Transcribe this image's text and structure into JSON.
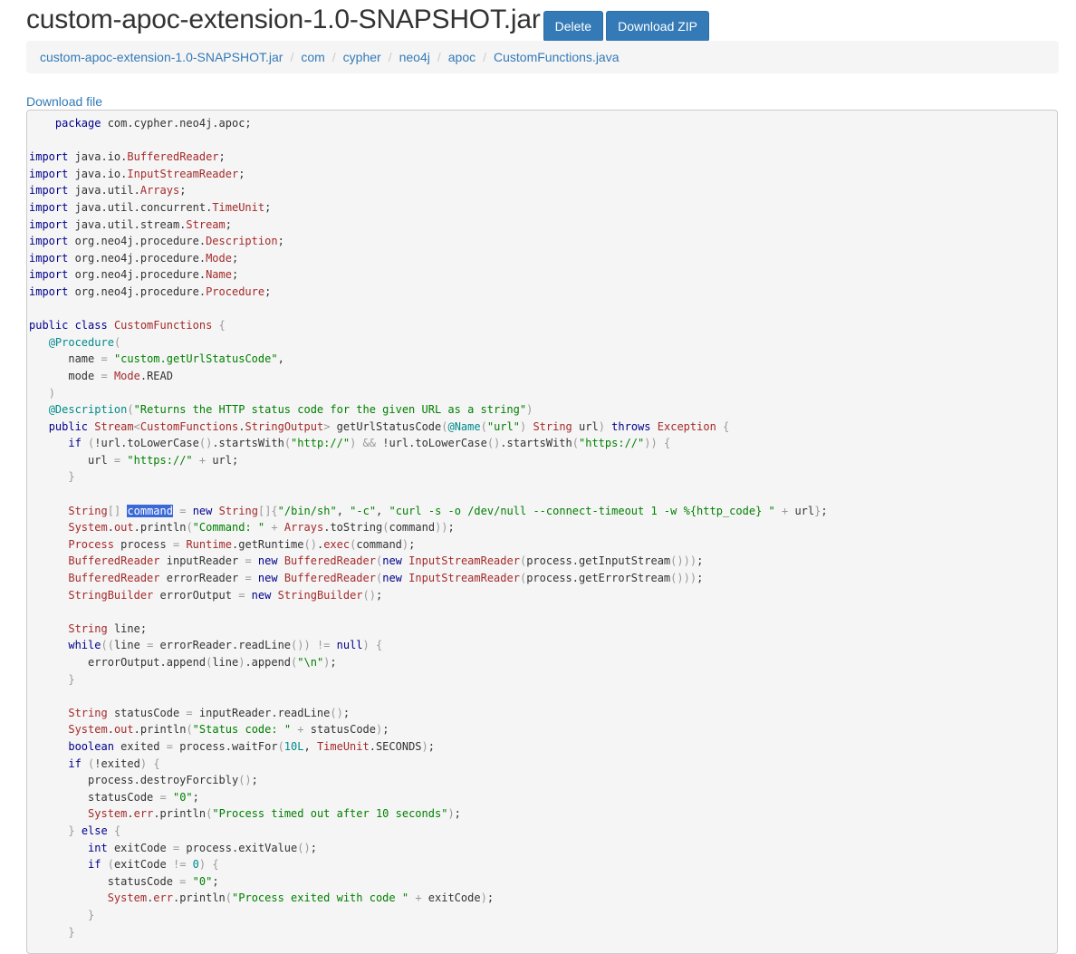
{
  "header": {
    "title": "custom-apoc-extension-1.0-SNAPSHOT.jar",
    "delete_label": "Delete",
    "download_zip_label": "Download ZIP"
  },
  "breadcrumb": [
    "custom-apoc-extension-1.0-SNAPSHOT.jar",
    "com",
    "cypher",
    "neo4j",
    "apoc",
    "CustomFunctions.java"
  ],
  "breadcrumb_separator": "/",
  "download_file_label": "Download file",
  "selected_text": "command",
  "code": [
    [
      [
        "t",
        "    "
      ],
      [
        "k",
        "package"
      ],
      [
        "t",
        " com.cypher.neo4j.apoc;"
      ]
    ],
    [],
    [
      [
        "k",
        "import"
      ],
      [
        "t",
        " java.io."
      ],
      [
        "y",
        "BufferedReader"
      ],
      [
        "t",
        ";"
      ]
    ],
    [
      [
        "k",
        "import"
      ],
      [
        "t",
        " java.io."
      ],
      [
        "y",
        "InputStreamReader"
      ],
      [
        "t",
        ";"
      ]
    ],
    [
      [
        "k",
        "import"
      ],
      [
        "t",
        " java.util."
      ],
      [
        "y",
        "Arrays"
      ],
      [
        "t",
        ";"
      ]
    ],
    [
      [
        "k",
        "import"
      ],
      [
        "t",
        " java.util.concurrent."
      ],
      [
        "y",
        "TimeUnit"
      ],
      [
        "t",
        ";"
      ]
    ],
    [
      [
        "k",
        "import"
      ],
      [
        "t",
        " java.util.stream."
      ],
      [
        "y",
        "Stream"
      ],
      [
        "t",
        ";"
      ]
    ],
    [
      [
        "k",
        "import"
      ],
      [
        "t",
        " org.neo4j.procedure."
      ],
      [
        "y",
        "Description"
      ],
      [
        "t",
        ";"
      ]
    ],
    [
      [
        "k",
        "import"
      ],
      [
        "t",
        " org.neo4j.procedure."
      ],
      [
        "y",
        "Mode"
      ],
      [
        "t",
        ";"
      ]
    ],
    [
      [
        "k",
        "import"
      ],
      [
        "t",
        " org.neo4j.procedure."
      ],
      [
        "y",
        "Name"
      ],
      [
        "t",
        ";"
      ]
    ],
    [
      [
        "k",
        "import"
      ],
      [
        "t",
        " org.neo4j.procedure."
      ],
      [
        "y",
        "Procedure"
      ],
      [
        "t",
        ";"
      ]
    ],
    [],
    [
      [
        "k",
        "public class"
      ],
      [
        "t",
        " "
      ],
      [
        "y",
        "CustomFunctions"
      ],
      [
        "t",
        " "
      ],
      [
        "p",
        "{"
      ]
    ],
    [
      [
        "t",
        "   "
      ],
      [
        "a",
        "@Procedure"
      ],
      [
        "p",
        "("
      ]
    ],
    [
      [
        "t",
        "      name "
      ],
      [
        "p",
        "="
      ],
      [
        "t",
        " "
      ],
      [
        "s",
        "\"custom.getUrlStatusCode\""
      ],
      [
        "t",
        ","
      ]
    ],
    [
      [
        "t",
        "      mode "
      ],
      [
        "p",
        "="
      ],
      [
        "t",
        " "
      ],
      [
        "y",
        "Mode"
      ],
      [
        "t",
        ".READ"
      ]
    ],
    [
      [
        "t",
        "   "
      ],
      [
        "p",
        ")"
      ]
    ],
    [
      [
        "t",
        "   "
      ],
      [
        "a",
        "@Description"
      ],
      [
        "p",
        "("
      ],
      [
        "s",
        "\"Returns the HTTP status code for the given URL as a string\""
      ],
      [
        "p",
        ")"
      ]
    ],
    [
      [
        "t",
        "   "
      ],
      [
        "k",
        "public"
      ],
      [
        "t",
        " "
      ],
      [
        "y",
        "Stream"
      ],
      [
        "p",
        "<"
      ],
      [
        "y",
        "CustomFunctions"
      ],
      [
        "t",
        "."
      ],
      [
        "y",
        "StringOutput"
      ],
      [
        "p",
        ">"
      ],
      [
        "t",
        " getUrlStatusCode"
      ],
      [
        "p",
        "("
      ],
      [
        "a",
        "@Name"
      ],
      [
        "p",
        "("
      ],
      [
        "s",
        "\"url\""
      ],
      [
        "p",
        ")"
      ],
      [
        "t",
        " "
      ],
      [
        "y",
        "String"
      ],
      [
        "t",
        " url"
      ],
      [
        "p",
        ")"
      ],
      [
        "t",
        " "
      ],
      [
        "k",
        "throws"
      ],
      [
        "t",
        " "
      ],
      [
        "y",
        "Exception"
      ],
      [
        "t",
        " "
      ],
      [
        "p",
        "{"
      ]
    ],
    [
      [
        "t",
        "      "
      ],
      [
        "k",
        "if"
      ],
      [
        "t",
        " "
      ],
      [
        "p",
        "("
      ],
      [
        "t",
        "!url.toLowerCase"
      ],
      [
        "p",
        "()"
      ],
      [
        "t",
        ".startsWith"
      ],
      [
        "p",
        "("
      ],
      [
        "s",
        "\"http://\""
      ],
      [
        "p",
        ")"
      ],
      [
        "t",
        " "
      ],
      [
        "p",
        "&&"
      ],
      [
        "t",
        " !url.toLowerCase"
      ],
      [
        "p",
        "()"
      ],
      [
        "t",
        ".startsWith"
      ],
      [
        "p",
        "("
      ],
      [
        "s",
        "\"https://\""
      ],
      [
        "p",
        "))"
      ],
      [
        "t",
        " "
      ],
      [
        "p",
        "{"
      ]
    ],
    [
      [
        "t",
        "         url "
      ],
      [
        "p",
        "="
      ],
      [
        "t",
        " "
      ],
      [
        "s",
        "\"https://\""
      ],
      [
        "t",
        " "
      ],
      [
        "p",
        "+"
      ],
      [
        "t",
        " url;"
      ]
    ],
    [
      [
        "t",
        "      "
      ],
      [
        "p",
        "}"
      ]
    ],
    [],
    [
      [
        "t",
        "      "
      ],
      [
        "y",
        "String"
      ],
      [
        "p",
        "[]"
      ],
      [
        "t",
        " "
      ],
      [
        "h",
        "command"
      ],
      [
        "t",
        " "
      ],
      [
        "p",
        "="
      ],
      [
        "t",
        " "
      ],
      [
        "k",
        "new"
      ],
      [
        "t",
        " "
      ],
      [
        "y",
        "String"
      ],
      [
        "p",
        "[]{"
      ],
      [
        "s",
        "\"/bin/sh\""
      ],
      [
        "t",
        ", "
      ],
      [
        "s",
        "\"-c\""
      ],
      [
        "t",
        ", "
      ],
      [
        "s",
        "\"curl -s -o /dev/null --connect-timeout 1 -w %{http_code} \""
      ],
      [
        "t",
        " "
      ],
      [
        "p",
        "+"
      ],
      [
        "t",
        " url"
      ],
      [
        "p",
        "}"
      ],
      [
        "t",
        ";"
      ]
    ],
    [
      [
        "t",
        "      "
      ],
      [
        "y",
        "System"
      ],
      [
        "t",
        "."
      ],
      [
        "y",
        "out"
      ],
      [
        "t",
        ".println"
      ],
      [
        "p",
        "("
      ],
      [
        "s",
        "\"Command: \""
      ],
      [
        "t",
        " "
      ],
      [
        "p",
        "+"
      ],
      [
        "t",
        " "
      ],
      [
        "y",
        "Arrays"
      ],
      [
        "t",
        ".toString"
      ],
      [
        "p",
        "("
      ],
      [
        "t",
        "command"
      ],
      [
        "p",
        "))"
      ],
      [
        "t",
        ";"
      ]
    ],
    [
      [
        "t",
        "      "
      ],
      [
        "y",
        "Process"
      ],
      [
        "t",
        " process "
      ],
      [
        "p",
        "="
      ],
      [
        "t",
        " "
      ],
      [
        "y",
        "Runtime"
      ],
      [
        "t",
        ".getRuntime"
      ],
      [
        "p",
        "()"
      ],
      [
        "t",
        "."
      ],
      [
        "y",
        "exec"
      ],
      [
        "p",
        "("
      ],
      [
        "t",
        "command"
      ],
      [
        "p",
        ")"
      ],
      [
        "t",
        ";"
      ]
    ],
    [
      [
        "t",
        "      "
      ],
      [
        "y",
        "BufferedReader"
      ],
      [
        "t",
        " inputReader "
      ],
      [
        "p",
        "="
      ],
      [
        "t",
        " "
      ],
      [
        "k",
        "new"
      ],
      [
        "t",
        " "
      ],
      [
        "y",
        "BufferedReader"
      ],
      [
        "p",
        "("
      ],
      [
        "k",
        "new"
      ],
      [
        "t",
        " "
      ],
      [
        "y",
        "InputStreamReader"
      ],
      [
        "p",
        "("
      ],
      [
        "t",
        "process.getInputStream"
      ],
      [
        "p",
        "()))"
      ],
      [
        "t",
        ";"
      ]
    ],
    [
      [
        "t",
        "      "
      ],
      [
        "y",
        "BufferedReader"
      ],
      [
        "t",
        " errorReader "
      ],
      [
        "p",
        "="
      ],
      [
        "t",
        " "
      ],
      [
        "k",
        "new"
      ],
      [
        "t",
        " "
      ],
      [
        "y",
        "BufferedReader"
      ],
      [
        "p",
        "("
      ],
      [
        "k",
        "new"
      ],
      [
        "t",
        " "
      ],
      [
        "y",
        "InputStreamReader"
      ],
      [
        "p",
        "("
      ],
      [
        "t",
        "process.getErrorStream"
      ],
      [
        "p",
        "()))"
      ],
      [
        "t",
        ";"
      ]
    ],
    [
      [
        "t",
        "      "
      ],
      [
        "y",
        "StringBuilder"
      ],
      [
        "t",
        " errorOutput "
      ],
      [
        "p",
        "="
      ],
      [
        "t",
        " "
      ],
      [
        "k",
        "new"
      ],
      [
        "t",
        " "
      ],
      [
        "y",
        "StringBuilder"
      ],
      [
        "p",
        "()"
      ],
      [
        "t",
        ";"
      ]
    ],
    [],
    [
      [
        "t",
        "      "
      ],
      [
        "y",
        "String"
      ],
      [
        "t",
        " line;"
      ]
    ],
    [
      [
        "t",
        "      "
      ],
      [
        "k",
        "while"
      ],
      [
        "p",
        "(("
      ],
      [
        "t",
        "line "
      ],
      [
        "p",
        "="
      ],
      [
        "t",
        " errorReader.readLine"
      ],
      [
        "p",
        "())"
      ],
      [
        "t",
        " "
      ],
      [
        "p",
        "!="
      ],
      [
        "t",
        " "
      ],
      [
        "k",
        "null"
      ],
      [
        "p",
        ")"
      ],
      [
        "t",
        " "
      ],
      [
        "p",
        "{"
      ]
    ],
    [
      [
        "t",
        "         errorOutput.append"
      ],
      [
        "p",
        "("
      ],
      [
        "t",
        "line"
      ],
      [
        "p",
        ")"
      ],
      [
        "t",
        ".append"
      ],
      [
        "p",
        "("
      ],
      [
        "s",
        "\"\\n\""
      ],
      [
        "p",
        ")"
      ],
      [
        "t",
        ";"
      ]
    ],
    [
      [
        "t",
        "      "
      ],
      [
        "p",
        "}"
      ]
    ],
    [],
    [
      [
        "t",
        "      "
      ],
      [
        "y",
        "String"
      ],
      [
        "t",
        " statusCode "
      ],
      [
        "p",
        "="
      ],
      [
        "t",
        " inputReader.readLine"
      ],
      [
        "p",
        "()"
      ],
      [
        "t",
        ";"
      ]
    ],
    [
      [
        "t",
        "      "
      ],
      [
        "y",
        "System"
      ],
      [
        "t",
        "."
      ],
      [
        "y",
        "out"
      ],
      [
        "t",
        ".println"
      ],
      [
        "p",
        "("
      ],
      [
        "s",
        "\"Status code: \""
      ],
      [
        "t",
        " "
      ],
      [
        "p",
        "+"
      ],
      [
        "t",
        " statusCode"
      ],
      [
        "p",
        ")"
      ],
      [
        "t",
        ";"
      ]
    ],
    [
      [
        "t",
        "      "
      ],
      [
        "k",
        "boolean"
      ],
      [
        "t",
        " exited "
      ],
      [
        "p",
        "="
      ],
      [
        "t",
        " process.waitFor"
      ],
      [
        "p",
        "("
      ],
      [
        "a",
        "10L"
      ],
      [
        "t",
        ", "
      ],
      [
        "y",
        "TimeUnit"
      ],
      [
        "t",
        ".SECONDS"
      ],
      [
        "p",
        ")"
      ],
      [
        "t",
        ";"
      ]
    ],
    [
      [
        "t",
        "      "
      ],
      [
        "k",
        "if"
      ],
      [
        "t",
        " "
      ],
      [
        "p",
        "("
      ],
      [
        "t",
        "!exited"
      ],
      [
        "p",
        ")"
      ],
      [
        "t",
        " "
      ],
      [
        "p",
        "{"
      ]
    ],
    [
      [
        "t",
        "         process.destroyForcibly"
      ],
      [
        "p",
        "()"
      ],
      [
        "t",
        ";"
      ]
    ],
    [
      [
        "t",
        "         statusCode "
      ],
      [
        "p",
        "="
      ],
      [
        "t",
        " "
      ],
      [
        "s",
        "\"0\""
      ],
      [
        "t",
        ";"
      ]
    ],
    [
      [
        "t",
        "         "
      ],
      [
        "y",
        "System"
      ],
      [
        "t",
        "."
      ],
      [
        "y",
        "err"
      ],
      [
        "t",
        ".println"
      ],
      [
        "p",
        "("
      ],
      [
        "s",
        "\"Process timed out after 10 seconds\""
      ],
      [
        "p",
        ")"
      ],
      [
        "t",
        ";"
      ]
    ],
    [
      [
        "t",
        "      "
      ],
      [
        "p",
        "}"
      ],
      [
        "t",
        " "
      ],
      [
        "k",
        "else"
      ],
      [
        "t",
        " "
      ],
      [
        "p",
        "{"
      ]
    ],
    [
      [
        "t",
        "         "
      ],
      [
        "k",
        "int"
      ],
      [
        "t",
        " exitCode "
      ],
      [
        "p",
        "="
      ],
      [
        "t",
        " process.exitValue"
      ],
      [
        "p",
        "()"
      ],
      [
        "t",
        ";"
      ]
    ],
    [
      [
        "t",
        "         "
      ],
      [
        "k",
        "if"
      ],
      [
        "t",
        " "
      ],
      [
        "p",
        "("
      ],
      [
        "t",
        "exitCode "
      ],
      [
        "p",
        "!="
      ],
      [
        "t",
        " "
      ],
      [
        "a",
        "0"
      ],
      [
        "p",
        ")"
      ],
      [
        "t",
        " "
      ],
      [
        "p",
        "{"
      ]
    ],
    [
      [
        "t",
        "            statusCode "
      ],
      [
        "p",
        "="
      ],
      [
        "t",
        " "
      ],
      [
        "s",
        "\"0\""
      ],
      [
        "t",
        ";"
      ]
    ],
    [
      [
        "t",
        "            "
      ],
      [
        "y",
        "System"
      ],
      [
        "t",
        "."
      ],
      [
        "y",
        "err"
      ],
      [
        "t",
        ".println"
      ],
      [
        "p",
        "("
      ],
      [
        "s",
        "\"Process exited with code \""
      ],
      [
        "t",
        " "
      ],
      [
        "p",
        "+"
      ],
      [
        "t",
        " exitCode"
      ],
      [
        "p",
        ")"
      ],
      [
        "t",
        ";"
      ]
    ],
    [
      [
        "t",
        "         "
      ],
      [
        "p",
        "}"
      ]
    ],
    [
      [
        "t",
        "      "
      ],
      [
        "p",
        "}"
      ]
    ]
  ]
}
